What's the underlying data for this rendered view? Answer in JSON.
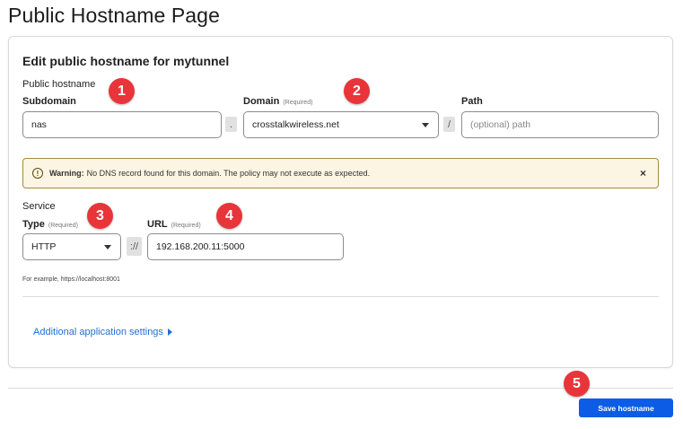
{
  "page": {
    "title": "Public Hostname Page"
  },
  "form": {
    "title": "Edit public hostname for mytunnel",
    "hostname_section_label": "Public hostname",
    "subdomain": {
      "label": "Subdomain",
      "value": "nas"
    },
    "dot_separator": ".",
    "domain": {
      "label": "Domain",
      "required_text": "(Required)",
      "value": "crosstalkwireless.net"
    },
    "slash_separator": "/",
    "path": {
      "label": "Path",
      "placeholder": "(optional) path"
    },
    "warning": {
      "icon": "!",
      "strong": "Warning:",
      "text": "No DNS record found for this domain. The policy may not execute as expected.",
      "close": "×"
    },
    "service_section_label": "Service",
    "type": {
      "label": "Type",
      "required_text": "(Required)",
      "value": "HTTP"
    },
    "scheme_separator": "://",
    "url": {
      "label": "URL",
      "required_text": "(Required)",
      "value": "192.168.200.11:5000"
    },
    "example": "For example, https://localhost:8001",
    "additional_settings": "Additional application settings"
  },
  "save_button": "Save hostname",
  "markers": [
    "1",
    "2",
    "3",
    "4",
    "5"
  ],
  "colors": {
    "accent": "#0c5ce6",
    "link": "#1f6fd6",
    "marker": "#e8353a",
    "warning_bg": "#fcf5e3"
  }
}
